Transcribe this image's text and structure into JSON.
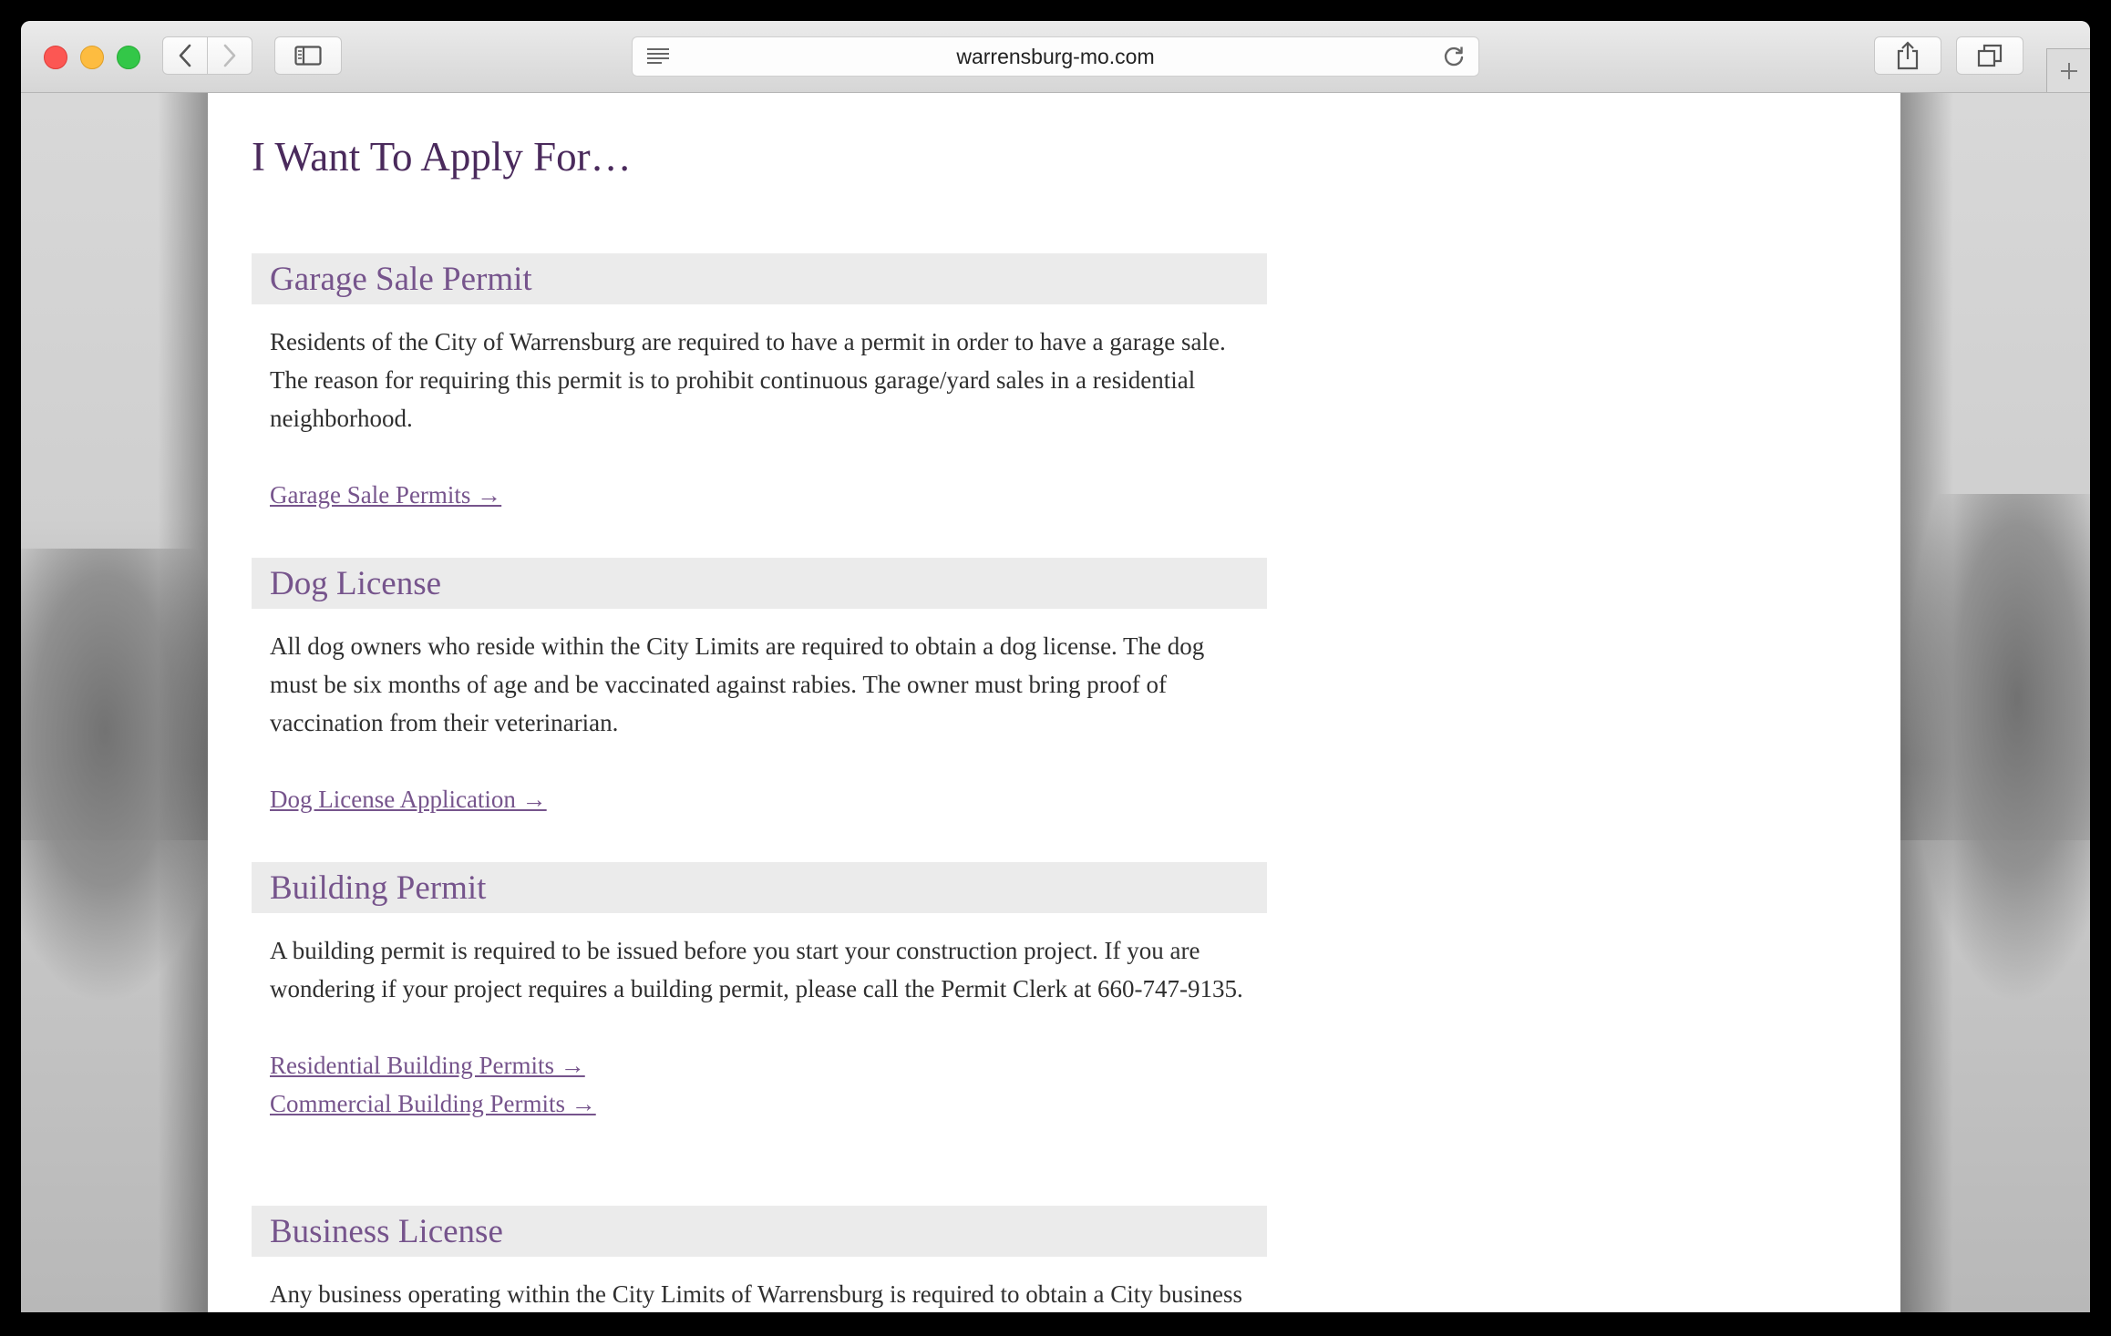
{
  "browser": {
    "address": "warrensburg-mo.com"
  },
  "page": {
    "title": "I Want To Apply For…",
    "sections": [
      {
        "title": "Garage Sale Permit",
        "body": "Residents of the City of Warrensburg are required to have a permit in order to have a garage sale. The reason for requiring this permit is to prohibit continuous garage/yard sales in a residential neighborhood.",
        "links": [
          "Garage Sale Permits →"
        ]
      },
      {
        "title": "Dog License",
        "body": "All dog owners who reside within the City Limits are required to obtain a dog license. The dog must be six months of age and be vaccinated against rabies. The owner must bring proof of vaccination from their veterinarian.",
        "links": [
          "Dog License Application →"
        ]
      },
      {
        "title": "Building Permit",
        "body": "A building permit is required to be issued before you start your construction project. If you are wondering if your project requires a building permit, please call the Permit Clerk at 660-747-9135.",
        "links": [
          "Residential Building Permits →",
          "Commercial Building Permits →"
        ]
      },
      {
        "title": "Business License",
        "body": "Any business operating within the City Limits of Warrensburg is required to obtain a City business license. These businesses pay a fee based on it's gross volume of business",
        "links": []
      }
    ]
  },
  "colors": {
    "title": "#4a2a5c",
    "section_title": "#76548c",
    "link": "#76548c",
    "header_bg": "#ebebeb"
  }
}
